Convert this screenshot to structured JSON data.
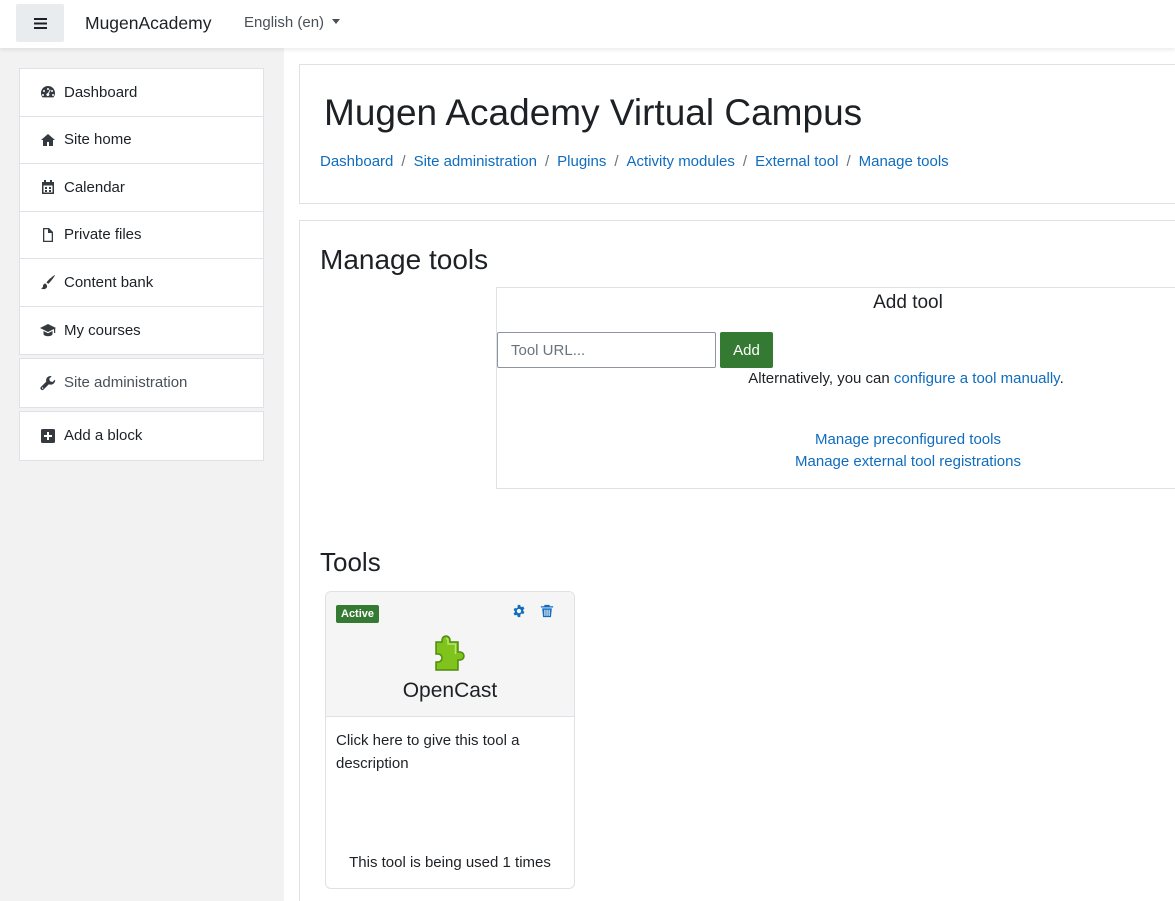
{
  "navbar": {
    "brand": "MugenAcademy",
    "language": "English (en)"
  },
  "drawer": {
    "main_items": [
      {
        "label": "Dashboard",
        "icon": "dashboard-icon"
      },
      {
        "label": "Site home",
        "icon": "home-icon"
      },
      {
        "label": "Calendar",
        "icon": "calendar-icon"
      },
      {
        "label": "Private files",
        "icon": "file-icon"
      },
      {
        "label": "Content bank",
        "icon": "paint-brush-icon"
      },
      {
        "label": "My courses",
        "icon": "graduation-cap-icon"
      }
    ],
    "admin_item": {
      "label": "Site administration",
      "icon": "wrench-icon"
    },
    "add_block": {
      "label": "Add a block",
      "icon": "plus-square-icon"
    }
  },
  "header": {
    "site_title": "Mugen Academy Virtual Campus",
    "breadcrumb": [
      "Dashboard",
      "Site administration",
      "Plugins",
      "Activity modules",
      "External tool",
      "Manage tools"
    ]
  },
  "manage": {
    "heading": "Manage tools",
    "add_tool": {
      "title": "Add tool",
      "url_placeholder": "Tool URL...",
      "add_label": "Add",
      "alt_prefix": "Alternatively, you can ",
      "alt_link": "configure a tool manually",
      "alt_suffix": "."
    },
    "links": {
      "preconfigured": "Manage preconfigured tools",
      "registrations": "Manage external tool registrations"
    }
  },
  "tools": {
    "heading": "Tools",
    "items": [
      {
        "status": "Active",
        "name": "OpenCast",
        "description": "Click here to give this tool a description",
        "usage": "This tool is being used 1 times"
      }
    ]
  },
  "colors": {
    "link": "#0f6cbf",
    "success": "#357a32",
    "page_bg": "#f2f2f2"
  }
}
